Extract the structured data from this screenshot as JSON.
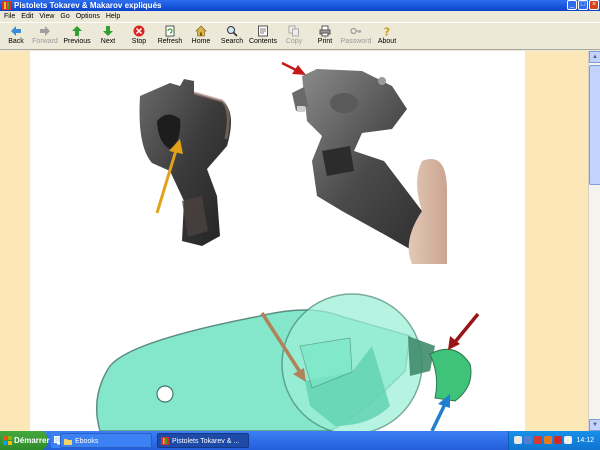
{
  "window": {
    "title": "Pistolets Tokarev & Makarov expliqués",
    "buttons": {
      "minimize": "_",
      "maximize": "□",
      "close": "×"
    }
  },
  "menu": [
    "File",
    "Edit",
    "View",
    "Go",
    "Options",
    "Help"
  ],
  "toolbar": [
    {
      "label": "Back",
      "icon": "arrow-left-icon",
      "enabled": true
    },
    {
      "label": "Forward",
      "icon": "arrow-right-icon",
      "enabled": false
    },
    {
      "label": "Previous",
      "icon": "arrow-up-icon",
      "enabled": true
    },
    {
      "label": "Next",
      "icon": "arrow-down-icon",
      "enabled": true
    },
    {
      "label": "Stop",
      "icon": "stop-icon",
      "enabled": true
    },
    {
      "label": "Refresh",
      "icon": "refresh-icon",
      "enabled": true
    },
    {
      "label": "Home",
      "icon": "home-icon",
      "enabled": true
    },
    {
      "label": "Search",
      "icon": "search-icon",
      "enabled": true
    },
    {
      "label": "Contents",
      "icon": "contents-icon",
      "enabled": true
    },
    {
      "label": "Copy",
      "icon": "copy-icon",
      "enabled": false
    },
    {
      "label": "Print",
      "icon": "print-icon",
      "enabled": true
    },
    {
      "label": "Password",
      "icon": "key-icon",
      "enabled": false
    },
    {
      "label": "About",
      "icon": "help-icon",
      "enabled": true
    }
  ],
  "colors": {
    "page_margin": "#fbe7b8",
    "arrow_orange": "#e3a11a",
    "arrow_red": "#c51a1a",
    "arrow_blue": "#2080d0",
    "part_cyan": "#6fe3c3",
    "part_green": "#3fc27a"
  },
  "taskbar": {
    "start_label": "Démarrer",
    "tasks": [
      {
        "label": "Ebooks",
        "icon": "folder-icon"
      },
      {
        "label": "Pistolets Tokarev & ...",
        "icon": "book-icon"
      }
    ],
    "clock": "14:12"
  }
}
